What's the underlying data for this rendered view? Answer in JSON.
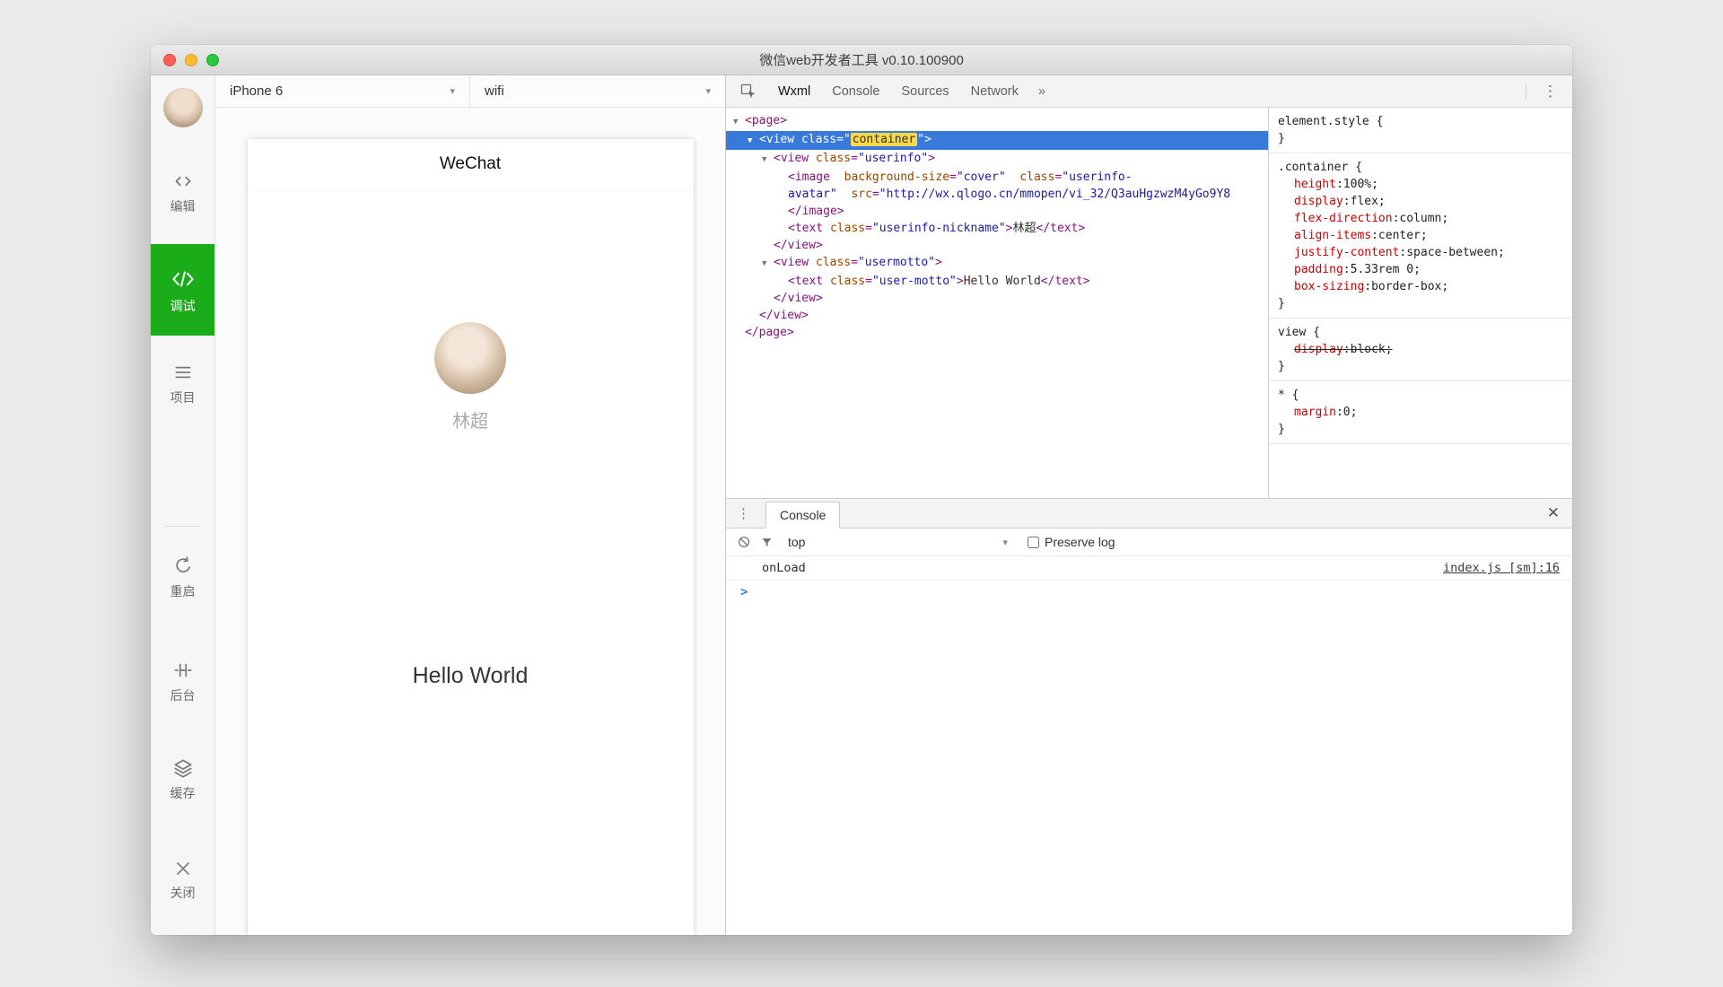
{
  "window": {
    "title": "微信web开发者工具 v0.10.100900"
  },
  "sidebar": {
    "items": [
      {
        "label": "编辑"
      },
      {
        "label": "调试"
      },
      {
        "label": "项目"
      },
      {
        "label": "重启"
      },
      {
        "label": "后台"
      },
      {
        "label": "缓存"
      },
      {
        "label": "关闭"
      }
    ]
  },
  "toolbar": {
    "device": "iPhone 6",
    "network": "wifi"
  },
  "preview": {
    "header_title": "WeChat",
    "nickname": "林超",
    "motto": "Hello World"
  },
  "devtools": {
    "tabs": [
      {
        "label": "Wxml"
      },
      {
        "label": "Console"
      },
      {
        "label": "Sources"
      },
      {
        "label": "Network"
      }
    ],
    "tabs_more": "»",
    "active_tab": "Wxml",
    "tree": [
      {
        "indent": 0,
        "arrow": true,
        "parts": [
          [
            "p",
            "<"
          ],
          [
            "t",
            "page"
          ],
          [
            "p",
            ">"
          ]
        ]
      },
      {
        "indent": 1,
        "arrow": true,
        "selected": true,
        "parts": [
          [
            "p",
            "<"
          ],
          [
            "t",
            "view"
          ],
          [
            "a",
            " class"
          ],
          [
            "p",
            "=\""
          ],
          [
            "h",
            "container"
          ],
          [
            "p",
            "\">"
          ]
        ]
      },
      {
        "indent": 2,
        "arrow": true,
        "parts": [
          [
            "p",
            "<"
          ],
          [
            "t",
            "view"
          ],
          [
            "a",
            " class"
          ],
          [
            "p",
            "="
          ],
          [
            "v",
            "\"userinfo\""
          ],
          [
            "p",
            ">"
          ]
        ]
      },
      {
        "indent": 3,
        "parts": [
          [
            "p",
            "<"
          ],
          [
            "t",
            "image"
          ],
          [
            "a",
            "  background-size"
          ],
          [
            "p",
            "="
          ],
          [
            "v",
            "\"cover\""
          ],
          [
            "a",
            "  class"
          ],
          [
            "p",
            "="
          ],
          [
            "v",
            "\"userinfo-"
          ]
        ]
      },
      {
        "indent": 3,
        "parts": [
          [
            "v",
            "avatar\""
          ],
          [
            "a",
            "  src"
          ],
          [
            "p",
            "="
          ],
          [
            "v",
            "\"http://wx.qlogo.cn/mmopen/vi_32/Q3auHgzwzM4yGo9Y8"
          ]
        ]
      },
      {
        "indent": 3,
        "parts": [
          [
            "p",
            "</"
          ],
          [
            "t",
            "image"
          ],
          [
            "p",
            ">"
          ]
        ]
      },
      {
        "indent": 3,
        "parts": [
          [
            "p",
            "<"
          ],
          [
            "t",
            "text"
          ],
          [
            "a",
            " class"
          ],
          [
            "p",
            "="
          ],
          [
            "v",
            "\"userinfo-nickname\""
          ],
          [
            "p",
            ">"
          ],
          [
            "x",
            "林超"
          ],
          [
            "p",
            "</"
          ],
          [
            "t",
            "text"
          ],
          [
            "p",
            ">"
          ]
        ]
      },
      {
        "indent": 2,
        "parts": [
          [
            "p",
            "</"
          ],
          [
            "t",
            "view"
          ],
          [
            "p",
            ">"
          ]
        ]
      },
      {
        "indent": 2,
        "arrow": true,
        "parts": [
          [
            "p",
            "<"
          ],
          [
            "t",
            "view"
          ],
          [
            "a",
            " class"
          ],
          [
            "p",
            "="
          ],
          [
            "v",
            "\"usermotto\""
          ],
          [
            "p",
            ">"
          ]
        ]
      },
      {
        "indent": 3,
        "parts": [
          [
            "p",
            "<"
          ],
          [
            "t",
            "text"
          ],
          [
            "a",
            " class"
          ],
          [
            "p",
            "="
          ],
          [
            "v",
            "\"user-motto\""
          ],
          [
            "p",
            ">"
          ],
          [
            "x",
            "Hello World"
          ],
          [
            "p",
            "</"
          ],
          [
            "t",
            "text"
          ],
          [
            "p",
            ">"
          ]
        ]
      },
      {
        "indent": 2,
        "parts": [
          [
            "p",
            "</"
          ],
          [
            "t",
            "view"
          ],
          [
            "p",
            ">"
          ]
        ]
      },
      {
        "indent": 1,
        "parts": [
          [
            "p",
            "</"
          ],
          [
            "t",
            "view"
          ],
          [
            "p",
            ">"
          ]
        ]
      },
      {
        "indent": 0,
        "parts": [
          [
            "p",
            "</"
          ],
          [
            "t",
            "page"
          ],
          [
            "p",
            ">"
          ]
        ]
      }
    ],
    "styles": [
      {
        "selector": "element.style",
        "props": []
      },
      {
        "selector": ".container",
        "props": [
          [
            "height",
            "100%",
            false
          ],
          [
            "display",
            "flex",
            false
          ],
          [
            "flex-direction",
            "column",
            false
          ],
          [
            "align-items",
            "center",
            false
          ],
          [
            "justify-content",
            "space-between",
            false
          ],
          [
            "padding",
            "5.33rem 0",
            false
          ],
          [
            "box-sizing",
            "border-box",
            false
          ]
        ]
      },
      {
        "selector": "view",
        "props": [
          [
            "display",
            "block",
            true
          ]
        ]
      },
      {
        "selector": "*",
        "props": [
          [
            "margin",
            "0",
            false
          ]
        ]
      }
    ],
    "console": {
      "tab_label": "Console",
      "context": "top",
      "preserve_label": "Preserve log",
      "log_message": "onLoad",
      "log_source": "index.js [sm]:16"
    }
  },
  "colors": {
    "wechat_green": "#1aad19",
    "selection_blue": "#3879d9",
    "tag_color": "#881280",
    "attr_name_color": "#994500",
    "attr_value_color": "#1a1aa6",
    "css_prop_name_color": "#c80000",
    "console_prompt_blue": "#2f7cf3"
  }
}
